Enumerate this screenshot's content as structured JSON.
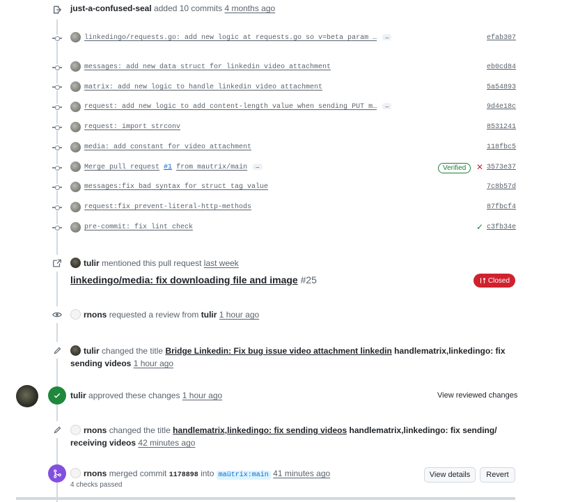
{
  "push": {
    "user": "just-a-confused-seal",
    "text": "added 10 commits",
    "time": "4 months ago"
  },
  "commits": [
    {
      "message": "linkedingo/requests.go: add new logic at requests.go so v=beta param …",
      "sha": "efab307",
      "ellipsis": "…"
    },
    {
      "message": "messages: add new data struct for linkedin video attachment",
      "sha": "eb0cd84"
    },
    {
      "message": "matrix: add new logic to handle linkedin video attachment",
      "sha": "5a54893"
    },
    {
      "message": "request: add new logic to add content-length value when sending PUT m…",
      "sha": "9d4e18c",
      "ellipsis": "…"
    },
    {
      "message": "request: import strconv",
      "sha": "8531241"
    },
    {
      "message": "media: add constant for video attachment",
      "sha": "118fbc5"
    },
    {
      "message_prefix": "Merge pull request",
      "message_link": "#1",
      "message_suffix": "from mautrix/main",
      "sha": "3573e37",
      "ellipsis": "…",
      "badge": "Verified",
      "status": "✕"
    },
    {
      "message": "messages:fix bad syntax for struct tag value",
      "sha": "7c8b57d"
    },
    {
      "message": "request:fix prevent-literal-http-methods",
      "sha": "87fbcf4"
    },
    {
      "message": "pre-commit: fix lint check",
      "sha": "c3fb34e",
      "status": "✓"
    }
  ],
  "mention": {
    "user": "tulir",
    "text": "mentioned this pull request",
    "time": "last week",
    "pr_title": "linkedingo/media: fix downloading file and image",
    "pr_number": "#25",
    "badge": "Closed"
  },
  "review_request": {
    "user": "rnons",
    "text": "requested a review from",
    "target": "tulir",
    "time": "1 hour ago"
  },
  "rename1": {
    "user": "tulir",
    "text": "changed the title",
    "old_title": "Bridge Linkedin: Fix bug issue video attachment linkedin",
    "new_title_a": "handlematrix,linkedingo: fix",
    "new_title_b": "sending videos",
    "time": "1 hour ago"
  },
  "approval": {
    "user": "tulir",
    "text": "approved these changes",
    "time": "1 hour ago",
    "link": "View reviewed changes"
  },
  "rename2": {
    "user": "rnons",
    "text": "changed the title",
    "old_title": "handlematrix,linkedingo: fix sending videos",
    "new_title_a": "handlematrix,linkedingo: fix sending/",
    "new_title_b": "receiving videos",
    "time": "42 minutes ago"
  },
  "merge": {
    "user": "rnons",
    "text": "merged commit",
    "commit": "1178898",
    "into": "into",
    "branch": "maütrix:main",
    "time": "41 minutes ago",
    "checks": "4 checks passed",
    "details_button": "View details",
    "revert_button": "Revert"
  },
  "colors": {
    "accent": "#0969da",
    "success": "#1a7f37",
    "danger": "#cf222e",
    "merged": "#8250df"
  }
}
